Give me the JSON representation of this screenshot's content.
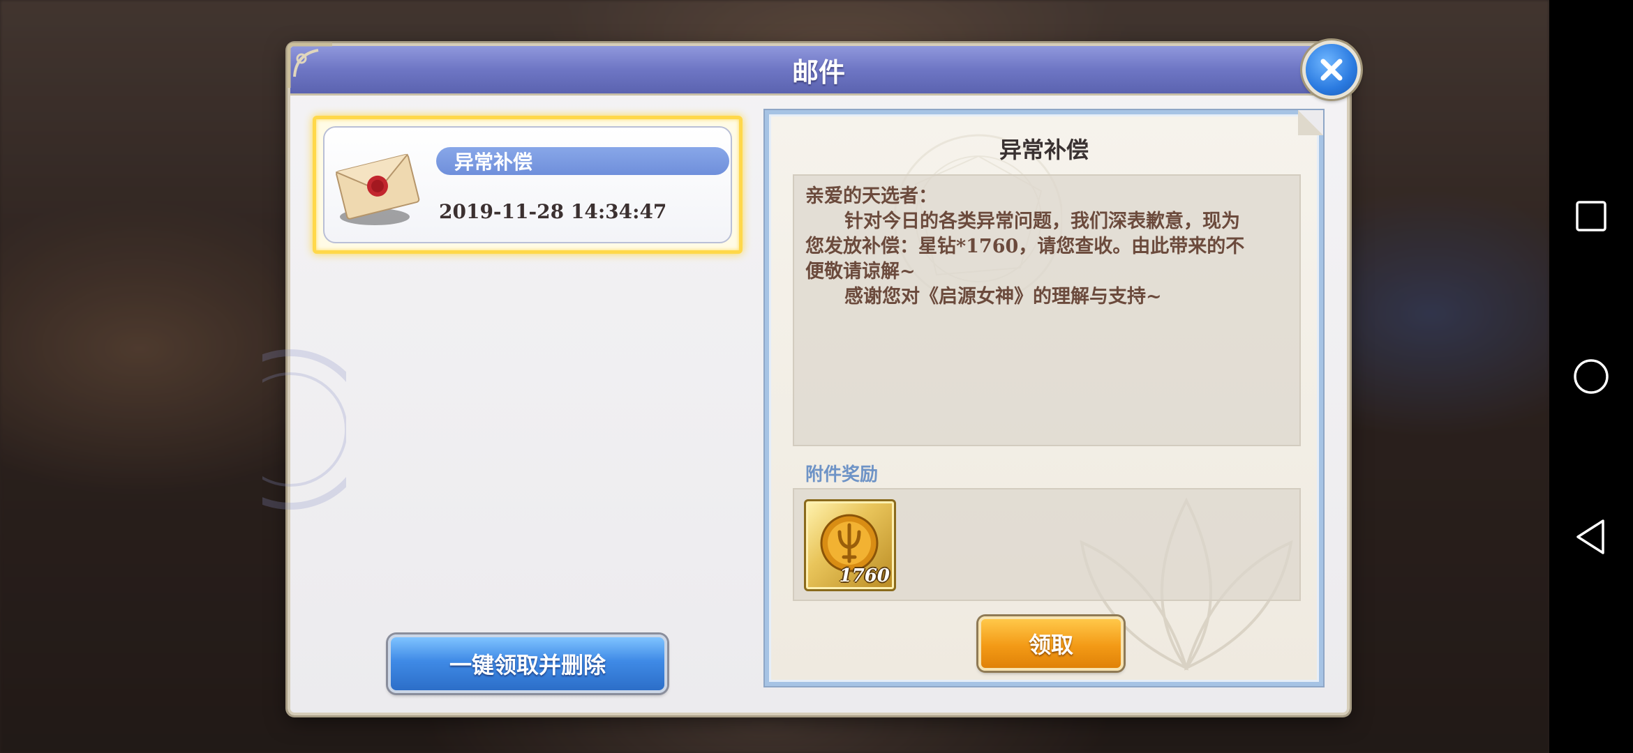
{
  "dialog": {
    "title": "邮件",
    "close_icon": "close-x-icon"
  },
  "mail_list": {
    "items": [
      {
        "subject": "异常补偿",
        "date": "2019-11-28  14:34:47",
        "icon": "sealed-envelope-icon",
        "selected": true
      }
    ],
    "claim_all_label": "一键领取并删除"
  },
  "detail": {
    "title": "异常补偿",
    "body": {
      "line1": "亲爱的天选者：",
      "line2": "针对今日的各类异常问题，我们深表歉意，现为",
      "line3": "您发放补偿：星钻*1760，请您查收。由此带来的不",
      "line4": "便敬请谅解~",
      "line5": "感谢您对《启源女神》的理解与支持~"
    },
    "attachment_label": "附件奖励",
    "rewards": [
      {
        "icon": "star-diamond-coin-icon",
        "count": "1760"
      }
    ],
    "claim_label": "领取"
  },
  "colors": {
    "title_bar": "#6e76c4",
    "selected_border": "#ffd84a",
    "claim_button": "#f39a16",
    "claim_all_button": "#3f8ae6",
    "body_text": "#6b4a3c"
  },
  "system_nav": {
    "recents_icon": "square-recents-icon",
    "home_icon": "circle-home-icon",
    "back_icon": "triangle-back-icon"
  }
}
